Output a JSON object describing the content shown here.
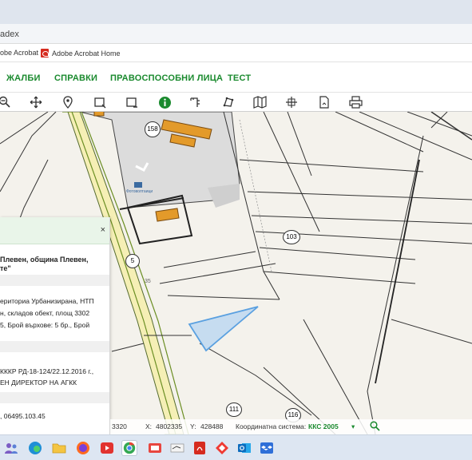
{
  "browser": {
    "address_text": "adex",
    "bookmarks": [
      {
        "label": "obe Acrobat"
      },
      {
        "label": "Adobe Acrobat Home"
      }
    ]
  },
  "nav": {
    "items": [
      "ЖАЛБИ",
      "СПРАВКИ",
      "ПРАВОСПОСОБНИ ЛИЦА",
      "ТЕСТ"
    ]
  },
  "toolbar": {
    "tools": [
      "zoom-out-icon",
      "pan-icon",
      "location-pin-icon",
      "select-rect-icon",
      "select-rect-minus-icon",
      "info-icon",
      "measure-icon",
      "polygon-icon",
      "map-icon",
      "crosshair-icon",
      "document-icon",
      "print-icon"
    ],
    "active_color": "#1a8a2e"
  },
  "map": {
    "labels": {
      "parcel_158": "158",
      "parcel_103": "103",
      "parcel_5": "5",
      "parcel_35": "35",
      "parcel_111": "111",
      "parcel_116": "116",
      "poi": "Фотоволтаици"
    },
    "highlight_color": "#5aa0e0"
  },
  "panel": {
    "close": "×",
    "title_line1": "Плевен, община Плевен,",
    "title_line2": "те\"",
    "desc_line1": "ериториа Урбанизирана, НТП",
    "desc_line2": "н, складов обект, площ 3302",
    "desc_line3": "5, Брой върхове: 5 бр., Брой",
    "order_line1": "КККР РД-18-124/22.12.2016 г.,",
    "order_line2": "ЕН ДИРЕКТОР НА АГКК",
    "id_line": ", 06495.103.45"
  },
  "status": {
    "left_value": "3320",
    "x_label": "X:",
    "x_value": "4802335",
    "y_label": "Y:",
    "y_value": "428488",
    "crs_label": "Координатна система:",
    "crs_value": "ККС 2005",
    "crs_caret": "▾",
    "accent": "#1a8a2e"
  },
  "taskbar": {
    "apps": [
      "people-icon",
      "edge-icon",
      "folder-icon",
      "firefox-icon",
      "video-icon",
      "chrome-icon",
      "app-icon",
      "app2-icon",
      "pdf-icon",
      "anydesk-icon",
      "outlook-icon",
      "dropbox-icon"
    ]
  }
}
